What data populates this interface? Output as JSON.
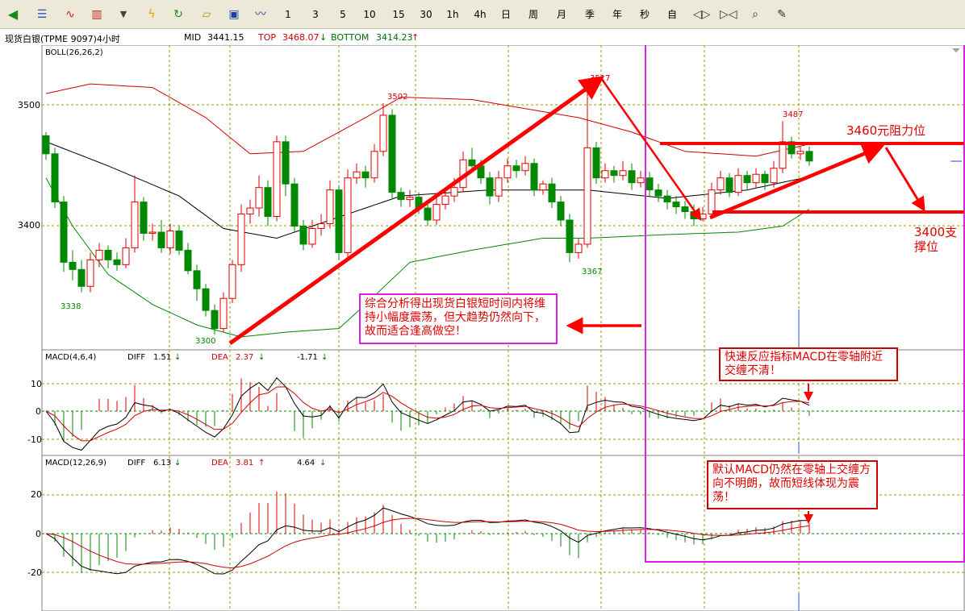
{
  "toolbar": {
    "icons": [
      "back-icon",
      "list-icon",
      "line-chart-icon",
      "bar-chart-icon",
      "dropdown-icon",
      "flash-icon",
      "refresh-icon",
      "folder-open-icon",
      "save-icon",
      "trend-icon"
    ],
    "periods": [
      "1",
      "3",
      "5",
      "10",
      "15",
      "30",
      "1h",
      "4h",
      "日",
      "周",
      "月",
      "季",
      "年",
      "秒",
      "自"
    ],
    "tools": [
      "step-left-icon",
      "step-right-icon",
      "zoom-icon",
      "draw-icon"
    ]
  },
  "instrument": {
    "title": "现货白银(TPME 9097)4小时"
  },
  "boll_header": {
    "mid_label": "MID",
    "mid_value": "3441.15",
    "top_label": "TOP",
    "top_value": "3468.07",
    "top_arrow": "↓",
    "bottom_label": "BOTTOM",
    "bottom_value": "3414.23",
    "bottom_arrow": "↑"
  },
  "panes": {
    "price": {
      "label": "BOLL(26,26,2)",
      "ticks": [
        "3500",
        "3400"
      ]
    },
    "macd1": {
      "label": "MACD(4,6,4)",
      "diff_label": "DIFF",
      "diff_value": "1.51",
      "diff_arrow": "↓",
      "dea_label": "DEA",
      "dea_value": "2.37",
      "dea_arrow": "↓",
      "macd_value": "-1.71",
      "macd_arrow": "↓",
      "ticks": [
        "10",
        "0",
        "-10"
      ]
    },
    "macd2": {
      "label": "MACD(12,26,9)",
      "diff_label": "DIFF",
      "diff_value": "6.13",
      "diff_arrow": "↓",
      "dea_label": "DEA",
      "dea_value": "3.81",
      "dea_arrow": "↑",
      "macd_value": "4.64",
      "macd_arrow": "↓",
      "ticks": [
        "20",
        "0",
        "-20"
      ]
    }
  },
  "price_labels": {
    "p3502": "3502",
    "p3517": "3517",
    "p3487": "3487",
    "p3338": "3338",
    "p3367": "3367",
    "p3300": "3300"
  },
  "annotations": {
    "analysis": "综合分析得出现货白银短时间内将维持小幅度震荡，但大趋势仍然向下，故而适合逢高做空！",
    "fast_macd": "快速反应指标MACD在零轴附近交缠不清！",
    "default_macd": "默认MACD仍然在零轴上交缠方向不明朗，故而短线体现为震荡！",
    "resistance": "3460元阻力位",
    "support_line1": "3400支",
    "support_line2": "撑位"
  },
  "colors": {
    "up": "#e00000",
    "down": "#008800",
    "grid": "#999900",
    "highlight": "#e020e0",
    "arrow": "#ff0000"
  },
  "chart_data": {
    "type": "candlestick",
    "ylim": [
      3300,
      3530
    ],
    "candles": [
      [
        3475,
        3460,
        3478,
        3455
      ],
      [
        3460,
        3420,
        3465,
        3415
      ],
      [
        3420,
        3370,
        3425,
        3362
      ],
      [
        3370,
        3364,
        3380,
        3355
      ],
      [
        3364,
        3350,
        3372,
        3345
      ],
      [
        3350,
        3372,
        3378,
        3345
      ],
      [
        3372,
        3380,
        3386,
        3366
      ],
      [
        3380,
        3372,
        3384,
        3365
      ],
      [
        3372,
        3368,
        3378,
        3363
      ],
      [
        3368,
        3382,
        3390,
        3365
      ],
      [
        3382,
        3420,
        3442,
        3378
      ],
      [
        3420,
        3394,
        3424,
        3388
      ],
      [
        3394,
        3395,
        3402,
        3388
      ],
      [
        3395,
        3382,
        3405,
        3378
      ],
      [
        3382,
        3396,
        3402,
        3377
      ],
      [
        3396,
        3380,
        3400,
        3376
      ],
      [
        3380,
        3363,
        3386,
        3360
      ],
      [
        3363,
        3348,
        3368,
        3338
      ],
      [
        3348,
        3330,
        3352,
        3325
      ],
      [
        3330,
        3315,
        3335,
        3310
      ],
      [
        3315,
        3340,
        3345,
        3312
      ],
      [
        3340,
        3368,
        3372,
        3336
      ],
      [
        3368,
        3410,
        3418,
        3362
      ],
      [
        3410,
        3415,
        3422,
        3402
      ],
      [
        3415,
        3432,
        3442,
        3408
      ],
      [
        3432,
        3408,
        3438,
        3400
      ],
      [
        3408,
        3470,
        3475,
        3404
      ],
      [
        3470,
        3435,
        3475,
        3425
      ],
      [
        3435,
        3400,
        3440,
        3395
      ],
      [
        3400,
        3385,
        3405,
        3380
      ],
      [
        3385,
        3398,
        3405,
        3382
      ],
      [
        3398,
        3402,
        3410,
        3392
      ],
      [
        3402,
        3430,
        3438,
        3398
      ],
      [
        3430,
        3378,
        3434,
        3372
      ],
      [
        3378,
        3440,
        3447,
        3372
      ],
      [
        3440,
        3445,
        3452,
        3435
      ],
      [
        3445,
        3440,
        3450,
        3432
      ],
      [
        3440,
        3462,
        3468,
        3436
      ],
      [
        3462,
        3492,
        3502,
        3458
      ],
      [
        3492,
        3428,
        3497,
        3422
      ],
      [
        3428,
        3422,
        3432,
        3416
      ],
      [
        3422,
        3424,
        3430,
        3416
      ],
      [
        3424,
        3415,
        3428,
        3410
      ],
      [
        3415,
        3405,
        3420,
        3400
      ],
      [
        3405,
        3418,
        3425,
        3401
      ],
      [
        3418,
        3425,
        3432,
        3414
      ],
      [
        3425,
        3432,
        3440,
        3420
      ],
      [
        3432,
        3455,
        3462,
        3428
      ],
      [
        3455,
        3450,
        3465,
        3446
      ],
      [
        3450,
        3440,
        3455,
        3435
      ],
      [
        3440,
        3425,
        3445,
        3418
      ],
      [
        3425,
        3440,
        3446,
        3420
      ],
      [
        3440,
        3450,
        3456,
        3436
      ],
      [
        3450,
        3446,
        3455,
        3440
      ],
      [
        3446,
        3452,
        3458,
        3442
      ],
      [
        3452,
        3430,
        3456,
        3425
      ],
      [
        3430,
        3435,
        3438,
        3426
      ],
      [
        3435,
        3420,
        3440,
        3415
      ],
      [
        3420,
        3405,
        3425,
        3400
      ],
      [
        3405,
        3378,
        3410,
        3370
      ],
      [
        3378,
        3385,
        3390,
        3373
      ],
      [
        3385,
        3465,
        3517,
        3382
      ],
      [
        3465,
        3440,
        3470,
        3435
      ],
      [
        3440,
        3446,
        3452,
        3436
      ],
      [
        3446,
        3442,
        3450,
        3436
      ],
      [
        3442,
        3446,
        3454,
        3438
      ],
      [
        3446,
        3436,
        3452,
        3430
      ],
      [
        3436,
        3440,
        3446,
        3432
      ],
      [
        3440,
        3430,
        3445,
        3425
      ],
      [
        3430,
        3425,
        3435,
        3420
      ],
      [
        3425,
        3420,
        3430,
        3414
      ],
      [
        3420,
        3416,
        3425,
        3410
      ],
      [
        3416,
        3412,
        3421,
        3406
      ],
      [
        3412,
        3406,
        3418,
        3400
      ],
      [
        3406,
        3410,
        3416,
        3404
      ],
      [
        3410,
        3430,
        3436,
        3406
      ],
      [
        3430,
        3440,
        3446,
        3426
      ],
      [
        3440,
        3428,
        3444,
        3424
      ],
      [
        3428,
        3442,
        3448,
        3425
      ],
      [
        3442,
        3436,
        3446,
        3430
      ],
      [
        3436,
        3443,
        3448,
        3432
      ],
      [
        3443,
        3436,
        3446,
        3430
      ],
      [
        3436,
        3448,
        3454,
        3432
      ],
      [
        3448,
        3470,
        3487,
        3444
      ],
      [
        3470,
        3460,
        3474,
        3456
      ],
      [
        3460,
        3462,
        3466,
        3455
      ],
      [
        3462,
        3454,
        3466,
        3450
      ]
    ],
    "boll_mid_samples": [
      [
        0,
        3470
      ],
      [
        7,
        3450
      ],
      [
        15,
        3425
      ],
      [
        20,
        3398
      ],
      [
        26,
        3390
      ],
      [
        32,
        3405
      ],
      [
        40,
        3425
      ],
      [
        50,
        3430
      ],
      [
        61,
        3430
      ],
      [
        70,
        3423
      ],
      [
        79,
        3430
      ],
      [
        86,
        3441
      ]
    ],
    "boll_top_samples": [
      [
        0,
        3510
      ],
      [
        5,
        3518
      ],
      [
        12,
        3515
      ],
      [
        18,
        3490
      ],
      [
        23,
        3460
      ],
      [
        29,
        3462
      ],
      [
        36,
        3490
      ],
      [
        40,
        3507
      ],
      [
        48,
        3505
      ],
      [
        56,
        3495
      ],
      [
        60,
        3490
      ],
      [
        66,
        3478
      ],
      [
        72,
        3462
      ],
      [
        80,
        3458
      ],
      [
        86,
        3468
      ]
    ],
    "boll_bottom_samples": [
      [
        0,
        3440
      ],
      [
        3,
        3400
      ],
      [
        7,
        3360
      ],
      [
        12,
        3335
      ],
      [
        17,
        3318
      ],
      [
        22,
        3308
      ],
      [
        27,
        3312
      ],
      [
        33,
        3315
      ],
      [
        36,
        3335
      ],
      [
        41,
        3370
      ],
      [
        48,
        3380
      ],
      [
        56,
        3390
      ],
      [
        61,
        3390
      ],
      [
        70,
        3393
      ],
      [
        78,
        3395
      ],
      [
        83,
        3400
      ],
      [
        86,
        3414
      ]
    ]
  }
}
